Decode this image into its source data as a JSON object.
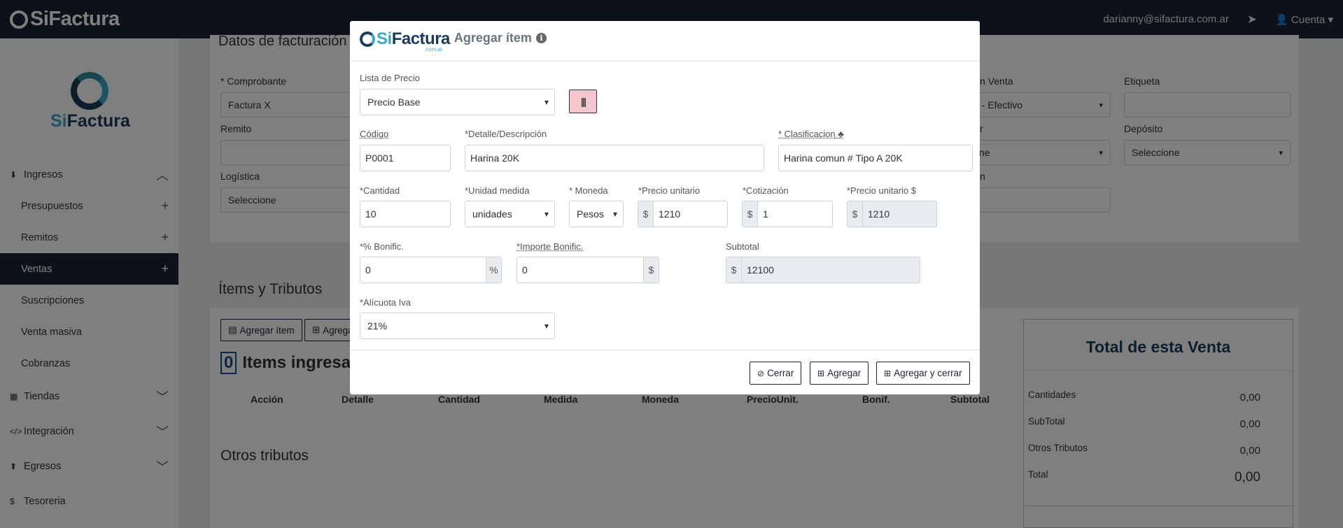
{
  "topbar": {
    "brand": "SiFactura",
    "user_email": "darianny@sifactura.com.ar",
    "account_label": "Cuenta"
  },
  "sidebar": {
    "logo_text_a": "Si",
    "logo_text_b": "Factura",
    "items": [
      {
        "label": "Ingresos"
      },
      {
        "label": "Presupuestos"
      },
      {
        "label": "Remitos"
      },
      {
        "label": "Ventas"
      },
      {
        "label": "Suscripciones"
      },
      {
        "label": "Venta masiva"
      },
      {
        "label": "Cobranzas"
      },
      {
        "label": "Tiendas"
      },
      {
        "label": "Integración"
      },
      {
        "label": "Egresos"
      },
      {
        "label": "Tesoreria"
      }
    ]
  },
  "background": {
    "section_title": "Datos de facturación",
    "comprobante_label": "* Comprobante",
    "comprobante_value": "Factura X",
    "remito_label": "Remito",
    "logistica_label": "Logística",
    "logistica_value": "Seleccione",
    "condicion_label": "n Venta",
    "condicion_value": "o - Efectivo",
    "etiqueta_label": "Etiqueta",
    "deposito_label": "Depósito",
    "deposito_value": "Seleccione",
    "r_label": "r",
    "r_value": "one",
    "n_label": "n",
    "items_title": "Ítems y Tributos",
    "agregar_item_btn": "Agregar ítem",
    "agregar_btn_partial": "Agrega",
    "items_count": "0",
    "items_ingresados": "Items ingresados",
    "table_headers": [
      "Acción",
      "Detalle",
      "Cantidad",
      "Medida",
      "Moneda",
      "PrecioUnit.",
      "Bonif.",
      "Subtotal"
    ],
    "otros_tributos_title": "Otros tributos",
    "totals": {
      "title": "Total de esta Venta",
      "rows": [
        {
          "label": "Cantidades",
          "value": "0,00"
        },
        {
          "label": "SubTotal",
          "value": "0,00"
        },
        {
          "label": "Otros Tributos",
          "value": "0,00"
        },
        {
          "label": "Total",
          "value": "0,00"
        }
      ]
    }
  },
  "modal": {
    "logo_a": "Si",
    "logo_b": "Factura",
    "logo_tld": ".com.ar",
    "title": "Agregar ítem",
    "lista_precio_label": "Lista de Precio",
    "lista_precio_value": "Precio Base",
    "codigo_label": "Código",
    "codigo_value": "P0001",
    "detalle_label": "*Detalle/Descripción",
    "detalle_value": "Harina 20K",
    "clasificacion_label": "* Clasificacion",
    "clasificacion_value": "Harina comun # Tipo A 20K",
    "cantidad_label": "*Cantidad",
    "cantidad_value": "10",
    "unidad_label": "*Unidad medida",
    "unidad_value": "unidades",
    "moneda_label": "* Moneda",
    "moneda_value": "Pesos",
    "precio_unitario_label": "*Precio unitario",
    "precio_unitario_value": "1210",
    "cotizacion_label": "*Cotización",
    "cotizacion_value": "1",
    "precio_unitario_usd_label": "*Precio unitario $",
    "precio_unitario_usd_value": "1210",
    "bonif_label": "*% Bonific.",
    "bonif_value": "0",
    "importe_bonif_label": "*Importe Bonific.",
    "importe_bonif_value": "0",
    "subtotal_label": "Subtotal",
    "subtotal_value": "12100",
    "alicuota_label": "*Alícuota Iva",
    "alicuota_value": "21%",
    "currency_symbol": "$",
    "percent_symbol": "%",
    "btn_cerrar": "Cerrar",
    "btn_agregar": "Agregar",
    "btn_agregar_cerrar": "Agregar y cerrar"
  }
}
